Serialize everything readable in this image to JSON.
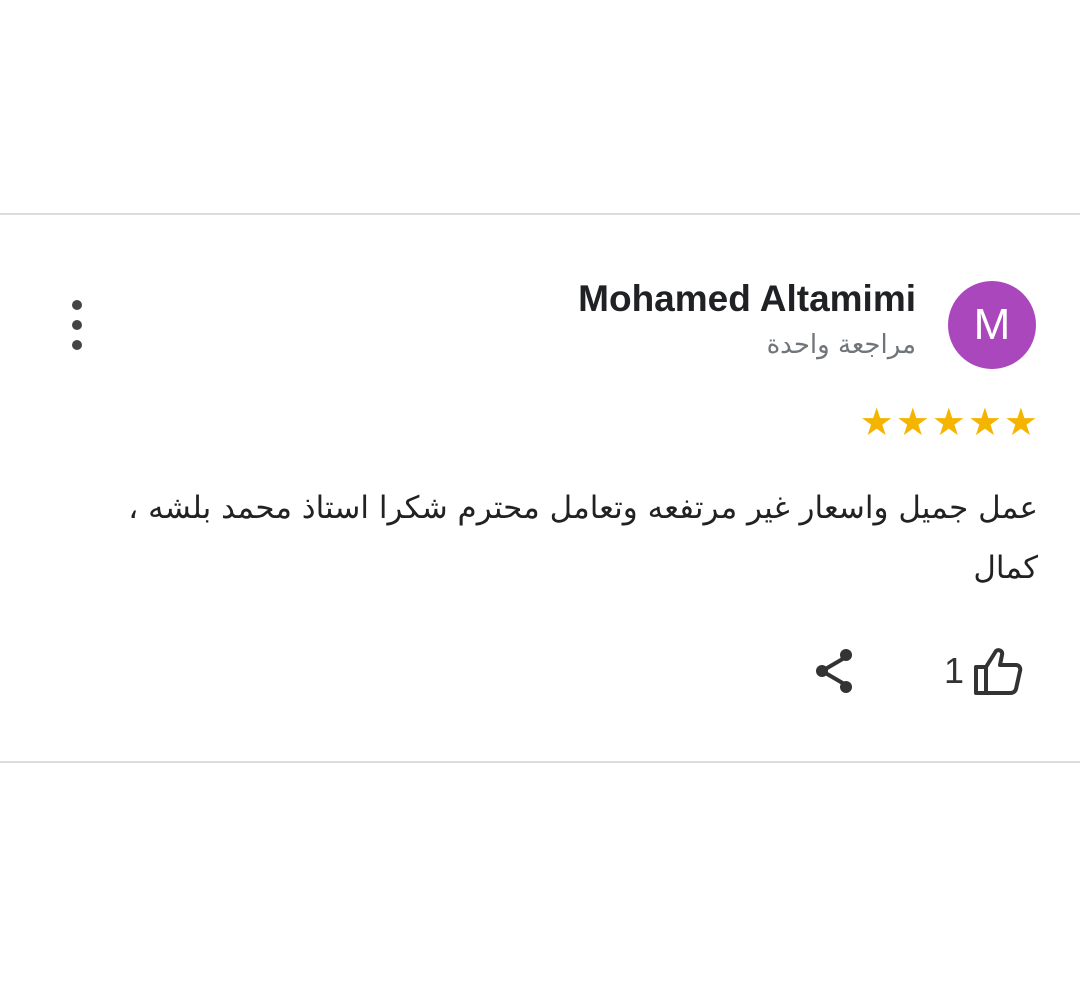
{
  "review": {
    "avatar_letter": "M",
    "avatar_color": "#ab47bc",
    "reviewer_name": "Mohamed Altamimi",
    "review_count_label": "مراجعة واحدة",
    "rating": 5,
    "rating_max": 5,
    "star_color": "#f5b400",
    "text": "عمل جميل واسعار غير مرتفعه وتعامل محترم شكرا استاذ محمد بلشه ، كمال",
    "like_count": "1"
  },
  "icons": {
    "menu": "more-vert-icon",
    "like": "thumb-up-icon",
    "share": "share-icon"
  }
}
